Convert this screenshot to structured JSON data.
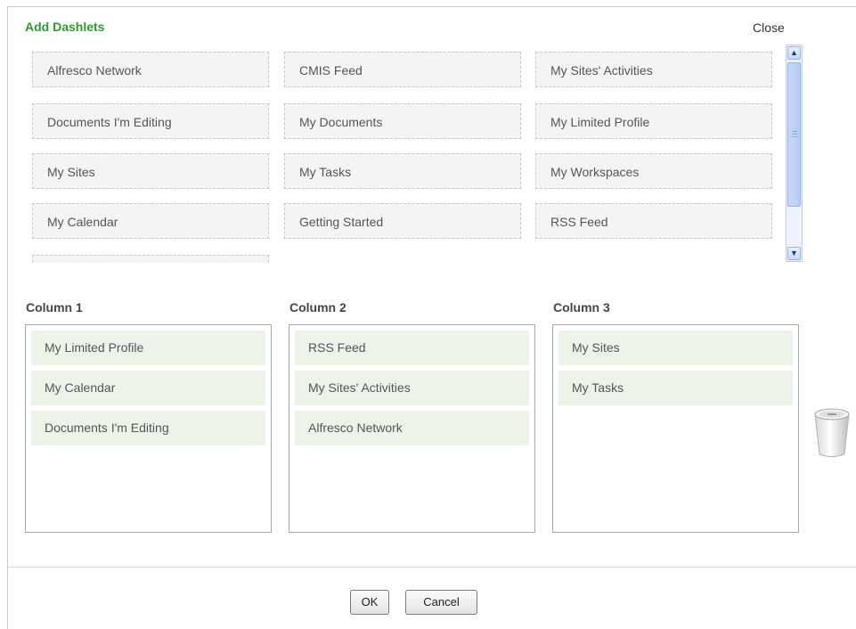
{
  "dialog": {
    "title": "Add Dashlets",
    "close_label": "Close"
  },
  "available_dashlets": [
    "Alfresco Network",
    "CMIS Feed",
    "My Sites' Activities",
    "Documents I'm Editing",
    "My Documents",
    "My Limited Profile",
    "My Sites",
    "My Tasks",
    "My Workspaces",
    "My Calendar",
    "Getting Started",
    "RSS Feed"
  ],
  "columns": [
    {
      "label": "Column 1",
      "items": [
        "My Limited Profile",
        "My Calendar",
        "Documents I'm Editing"
      ]
    },
    {
      "label": "Column 2",
      "items": [
        "RSS Feed",
        "My Sites' Activities",
        "Alfresco Network"
      ]
    },
    {
      "label": "Column 3",
      "items": [
        "My Sites",
        "My Tasks"
      ]
    }
  ],
  "buttons": {
    "ok_label": "OK",
    "cancel_label": "Cancel"
  },
  "icons": {
    "trash": "trash-icon",
    "scroll_up": "arrow-up-icon",
    "scroll_down": "arrow-down-icon"
  }
}
